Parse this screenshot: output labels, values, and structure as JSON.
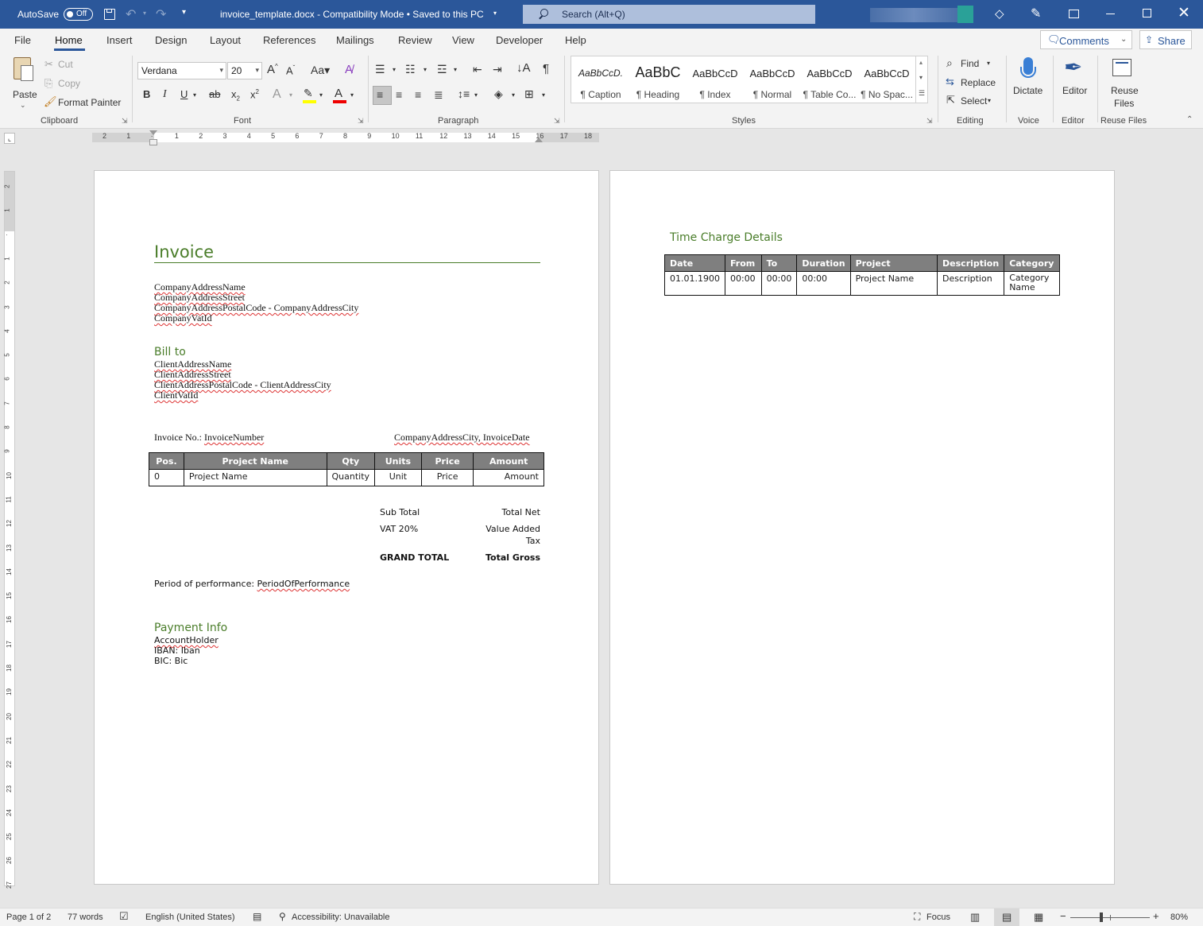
{
  "titlebar": {
    "autosave_label": "AutoSave",
    "autosave_state": "Off",
    "doc_title": "invoice_template.docx  -  Compatibility Mode • Saved to this PC",
    "search_placeholder": "Search (Alt+Q)"
  },
  "menu": {
    "items": [
      "File",
      "Home",
      "Insert",
      "Design",
      "Layout",
      "References",
      "Mailings",
      "Review",
      "View",
      "Developer",
      "Help"
    ],
    "active": "Home",
    "comments_label": "Comments",
    "share_label": "Share"
  },
  "ribbon": {
    "clipboard": {
      "paste": "Paste",
      "cut": "Cut",
      "copy": "Copy",
      "format_painter": "Format Painter",
      "label": "Clipboard"
    },
    "font": {
      "family": "Verdana",
      "size": "20",
      "label": "Font"
    },
    "paragraph": {
      "label": "Paragraph"
    },
    "styles": {
      "label": "Styles",
      "items": [
        {
          "preview": "AaBbCcD.",
          "name": "¶ Caption"
        },
        {
          "preview": "AaBbC",
          "name": "¶ Heading"
        },
        {
          "preview": "AaBbCcD",
          "name": "¶ Index"
        },
        {
          "preview": "AaBbCcD",
          "name": "¶ Normal"
        },
        {
          "preview": "AaBbCcD",
          "name": "¶ Table Co..."
        },
        {
          "preview": "AaBbCcD",
          "name": "¶ No Spac..."
        }
      ]
    },
    "editing": {
      "find": "Find",
      "replace": "Replace",
      "select": "Select",
      "label": "Editing"
    },
    "voice": {
      "dictate": "Dictate",
      "label": "Voice"
    },
    "editor": {
      "editor": "Editor",
      "label": "Editor"
    },
    "reuse": {
      "line1": "Reuse",
      "line2": "Files",
      "label": "Reuse Files"
    }
  },
  "ruler": {
    "numbers": [
      "2",
      "1",
      "",
      "1",
      "2",
      "3",
      "4",
      "5",
      "6",
      "7",
      "8",
      "9",
      "10",
      "11",
      "12",
      "13",
      "14",
      "15",
      "16",
      "17",
      "18"
    ]
  },
  "vruler": {
    "numbers": [
      "2",
      "1",
      "",
      "1",
      "2",
      "3",
      "4",
      "5",
      "6",
      "7",
      "8",
      "9",
      "10",
      "11",
      "12",
      "13",
      "14",
      "15",
      "16",
      "17",
      "18",
      "19",
      "20",
      "21",
      "22",
      "23",
      "24",
      "25",
      "26",
      "27"
    ]
  },
  "page1": {
    "title": "Invoice",
    "company": [
      "CompanyAddressName",
      "CompanyAddressStreet",
      "CompanyAddressPostalCode - CompanyAddressCity",
      "CompanyVatId"
    ],
    "bill_to_heading": "Bill to",
    "client": [
      "ClientAddressName",
      "ClientAddressStreet",
      "ClientAddressPostalCode - ClientAddressCity",
      "ClientVatId"
    ],
    "invoice_no_label": "Invoice No.: ",
    "invoice_no_value": "InvoiceNumber",
    "city_date": "CompanyAddressCity, InvoiceDate",
    "items_table": {
      "headers": [
        "Pos.",
        "Project Name",
        "Qty",
        "Units",
        "Price",
        "Amount"
      ],
      "rows": [
        [
          "0",
          "Project Name",
          "Quantity",
          "Unit",
          "Price",
          "Amount"
        ]
      ]
    },
    "totals": {
      "subtotal_label": "Sub Total",
      "subtotal_value": "Total Net",
      "vat_label": "VAT 20%",
      "vat_value_1": "Value Added",
      "vat_value_2": "Tax",
      "grand_label": "GRAND TOTAL",
      "grand_value": "Total Gross"
    },
    "period_label": "Period of performance: ",
    "period_value": "PeriodOfPerformance",
    "payment_heading": "Payment Info",
    "account_holder": "AccountHolder",
    "iban": "IBAN: Iban",
    "bic": "BIC: Bic"
  },
  "page2": {
    "heading": "Time Charge Details",
    "table": {
      "headers": [
        "Date",
        "From",
        "To",
        "Duration",
        "Project",
        "Description",
        "Category"
      ],
      "row": [
        "01.01.1900",
        "00:00",
        "00:00",
        "00:00",
        "Project Name",
        "Description",
        "Category",
        "Name"
      ]
    }
  },
  "statusbar": {
    "page": "Page 1 of 2",
    "words": "77 words",
    "language": "English (United States)",
    "accessibility": "Accessibility: Unavailable",
    "focus": "Focus",
    "zoom": "80%"
  },
  "colors": {
    "titlebar": "#2b579a",
    "heading_green": "#4a7d2a",
    "table_header": "#7f7f7f"
  }
}
